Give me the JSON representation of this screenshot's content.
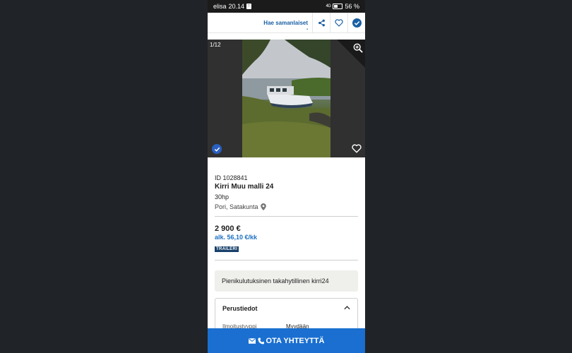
{
  "status_bar": {
    "carrier": "elisa",
    "time": "20.14",
    "upload_glyph": "↑",
    "signal": "4G",
    "battery": "56 %"
  },
  "topbar": {
    "similar_label": "Hae samanlaiset",
    "similar_dot": "•"
  },
  "gallery": {
    "counter": "1/12"
  },
  "listing": {
    "id": "ID 1028841",
    "title": "Kirri Muu malli 24",
    "subtitle": "30hp",
    "location": "Pori, Satakunta",
    "price": "2 900 €",
    "monthly": "alk. 56,10 €/kk",
    "tag": "TRAILERI"
  },
  "description": "Pienikulutuksinen takahytillinen kirri24",
  "basic_info": {
    "title": "Perustiedot",
    "rows": [
      {
        "label": "Ilmoitustyyppi",
        "value": "Myydään"
      }
    ]
  },
  "cta": {
    "label": "OTA YHTEYTTÄ"
  },
  "colors": {
    "accent": "#1a6fd0",
    "link": "#1a5fa3",
    "tag_bg": "#18406b",
    "check_badge": "#2a5fbf"
  },
  "icons": [
    "share-icon",
    "heart-icon",
    "check-circle-icon",
    "zoom-in-icon",
    "location-pin-icon",
    "chevron-up-icon",
    "mail-icon",
    "phone-icon"
  ]
}
